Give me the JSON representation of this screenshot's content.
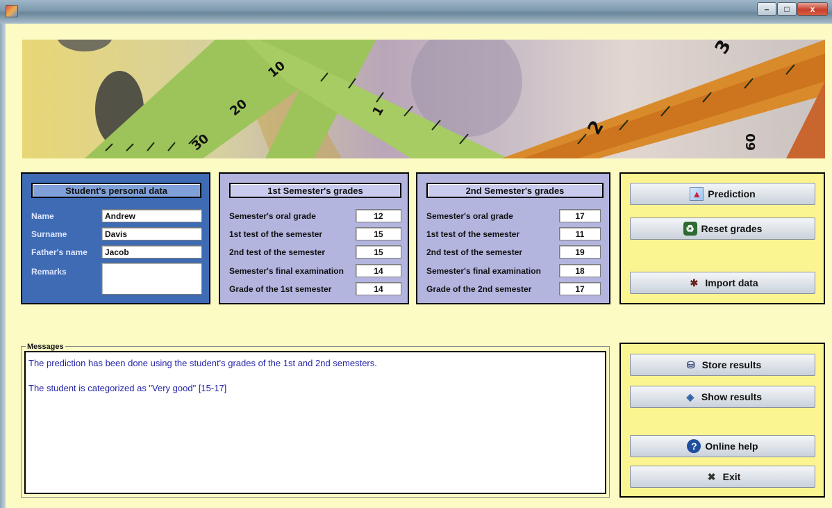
{
  "window": {
    "controls": {
      "minimize": "–",
      "maximize": "□",
      "close": "x"
    }
  },
  "banner": {
    "ruler_numbers": [
      "10",
      "20",
      "30",
      "1",
      "2",
      "3",
      "60"
    ]
  },
  "personal": {
    "header": "Student's personal data",
    "fields": [
      {
        "label": "Name",
        "value": "Andrew"
      },
      {
        "label": "Surname",
        "value": "Davis"
      },
      {
        "label": "Father's name",
        "value": "Jacob"
      },
      {
        "label": "Remarks",
        "value": ""
      }
    ]
  },
  "sem1": {
    "header": "1st Semester's grades",
    "fields": [
      {
        "label": "Semester's oral grade",
        "value": "12"
      },
      {
        "label": "1st test of the semester",
        "value": "15"
      },
      {
        "label": "2nd test of the semester",
        "value": "15"
      },
      {
        "label": "Semester's final examination",
        "value": "14"
      },
      {
        "label": "Grade of the 1st semester",
        "value": "14"
      }
    ]
  },
  "sem2": {
    "header": "2nd Semester's grades",
    "fields": [
      {
        "label": "Semester's oral grade",
        "value": "17"
      },
      {
        "label": "1st test of the semester",
        "value": "11"
      },
      {
        "label": "2nd test of the semester",
        "value": "19"
      },
      {
        "label": "Semester's final examination",
        "value": "18"
      },
      {
        "label": "Grade of the 2nd semester",
        "value": "17"
      }
    ]
  },
  "actions": {
    "prediction": "Prediction",
    "reset": "Reset grades",
    "import": "Import data",
    "store": "Store results",
    "show": "Show results",
    "help": "Online help",
    "exit": "Exit"
  },
  "icons": {
    "prediction": "chart-icon",
    "reset": "recycle-icon",
    "import": "import-icon",
    "store": "store-icon",
    "show": "show-icon",
    "help": "help-icon",
    "exit": "exit-icon"
  },
  "messages": {
    "legend": "Messages",
    "lines": [
      "The prediction has been done using the student's grades of the 1st and 2nd semesters.",
      "The student is categorized as \"Very good\" [15-17]"
    ]
  },
  "colors": {
    "background": "#fdfbc4",
    "personal_panel": "#3e6bb4",
    "semester_panel": "#b3b5df",
    "actions_panel": "#fbf591",
    "message_text": "#2424a8"
  }
}
